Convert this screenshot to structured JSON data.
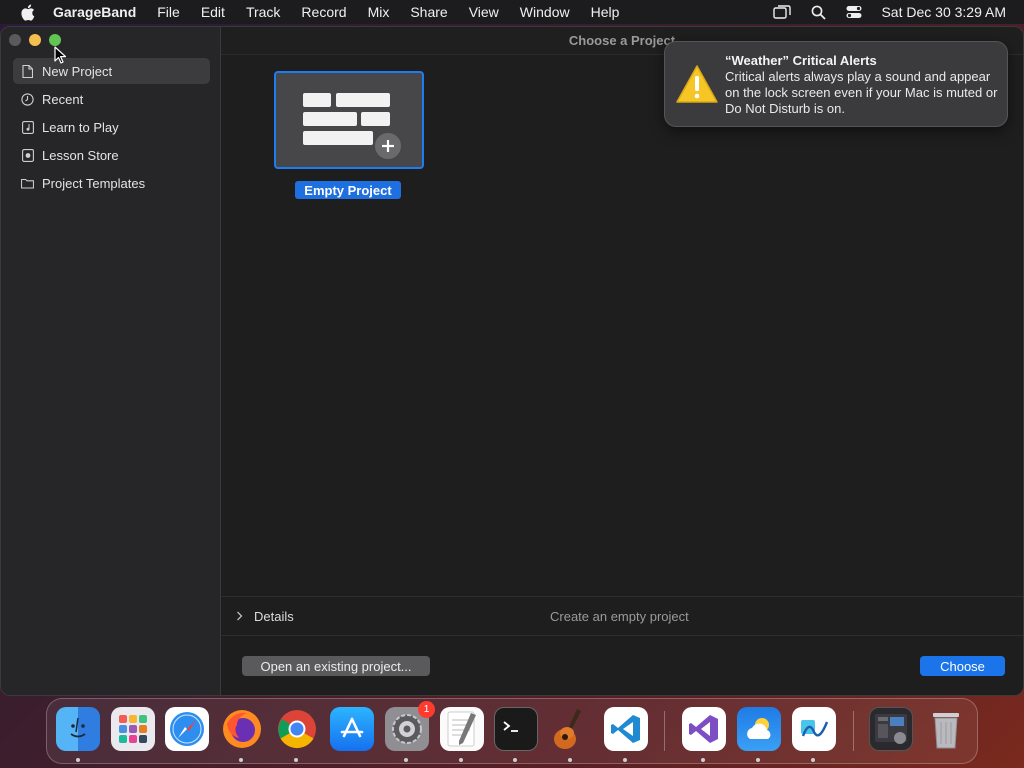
{
  "menubar": {
    "app_name": "GarageBand",
    "items": [
      "File",
      "Edit",
      "Track",
      "Record",
      "Mix",
      "Share",
      "View",
      "Window",
      "Help"
    ],
    "clock": "Sat Dec 30  3:29 AM"
  },
  "window": {
    "title": "Choose a Project",
    "sidebar": {
      "items": [
        {
          "label": "New Project",
          "icon": "document-icon",
          "selected": true
        },
        {
          "label": "Recent",
          "icon": "clock-icon",
          "selected": false
        },
        {
          "label": "Learn to Play",
          "icon": "learn-icon",
          "selected": false
        },
        {
          "label": "Lesson Store",
          "icon": "store-icon",
          "selected": false
        },
        {
          "label": "Project Templates",
          "icon": "folder-icon",
          "selected": false
        }
      ]
    },
    "project_tile": {
      "label": "Empty Project"
    },
    "details": {
      "label": "Details",
      "description": "Create an empty project"
    },
    "buttons": {
      "open_existing": "Open an existing project...",
      "choose": "Choose"
    }
  },
  "notification": {
    "title": "“Weather” Critical Alerts",
    "body": "Critical alerts always play a sound and appear on the lock screen even if your Mac is muted or Do Not Disturb is on."
  },
  "dock": {
    "apps": [
      "Finder",
      "Launchpad",
      "Safari",
      "Firefox",
      "Chrome",
      "App Store",
      "System Settings",
      "TextEdit",
      "Terminal",
      "GarageBand",
      "Visual Studio Code",
      "Visual Studio",
      "Weather",
      "Freeform",
      "Downloads",
      "Trash"
    ],
    "settings_badge": "1"
  },
  "colors": {
    "accent": "#1c74ea",
    "selection_border": "#1e7cf2",
    "badge": "#ff3b30"
  }
}
